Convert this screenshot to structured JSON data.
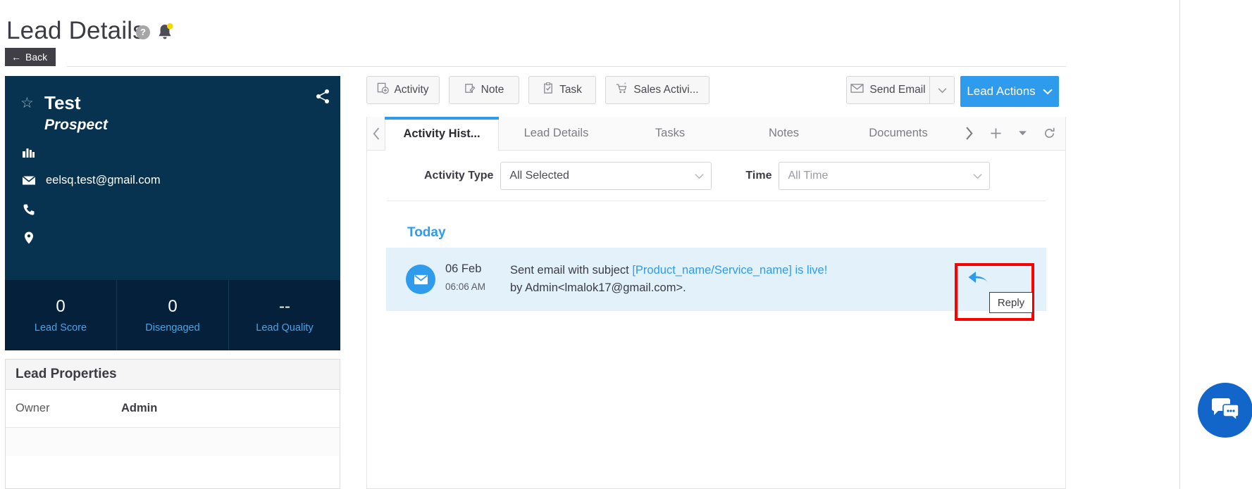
{
  "header": {
    "title": "Lead Details",
    "help_icon": "help-circle-icon",
    "bell_icon": "bell-notification-icon",
    "back_label": "Back",
    "back_arrow": "←"
  },
  "lead_card": {
    "star_icon": "star-outline-icon",
    "share_icon": "share-nodes-icon",
    "name": "Test",
    "stage": "Prospect",
    "rows": [
      {
        "icon": "company-building-icon",
        "value": ""
      },
      {
        "icon": "envelope-icon",
        "value": "eelsq.test@gmail.com"
      },
      {
        "icon": "phone-icon",
        "value": ""
      },
      {
        "icon": "location-pin-icon",
        "value": ""
      }
    ],
    "stats": [
      {
        "value": "0",
        "label": "Lead Score"
      },
      {
        "value": "0",
        "label": "Disengaged"
      },
      {
        "value": "--",
        "label": "Lead Quality"
      }
    ]
  },
  "lead_properties": {
    "title": "Lead Properties",
    "rows": [
      {
        "key": "Owner",
        "value": "Admin"
      }
    ]
  },
  "toolbar": {
    "activity_label": "Activity",
    "activity_icon": "activity-add-icon",
    "note_label": "Note",
    "note_icon": "note-pencil-icon",
    "task_label": "Task",
    "task_icon": "clipboard-check-icon",
    "sales_label": "Sales Activi...",
    "sales_icon": "cart-star-icon",
    "send_email_label": "Send Email",
    "send_email_icon": "envelope-icon",
    "send_email_caret": "chevron-down-icon",
    "lead_actions_label": "Lead Actions",
    "lead_actions_caret": "chevron-down-icon"
  },
  "tabs": {
    "scroll_left_icon": "chevron-left-icon",
    "items": [
      {
        "label": "Activity Hist...",
        "active": true
      },
      {
        "label": "Lead Details",
        "active": false
      },
      {
        "label": "Tasks",
        "active": false
      },
      {
        "label": "Notes",
        "active": false
      },
      {
        "label": "Documents",
        "active": false
      }
    ],
    "tools": [
      {
        "icon": "chevron-right-icon"
      },
      {
        "icon": "plus-icon"
      },
      {
        "icon": "chevron-down-icon"
      },
      {
        "icon": "refresh-icon"
      }
    ]
  },
  "filters": {
    "activity_type_label": "Activity Type",
    "activity_type_value": "All Selected",
    "time_label": "Time",
    "time_value": "All Time",
    "caret_icon": "chevron-down-icon"
  },
  "activity_feed": {
    "group_label": "Today",
    "items": [
      {
        "icon": "email-envelope-icon",
        "date": "06 Feb",
        "time": "06:06 AM",
        "text_prefix": "Sent email with subject ",
        "subject_link": "[Product_name/Service_name] is live!",
        "text_middle": " by ",
        "sender_link": "Admin<lmalok17@gmail.com>",
        "text_suffix": "."
      }
    ]
  },
  "reply_control": {
    "icon": "reply-arrow-icon",
    "tooltip": "Reply",
    "highlight_color": "#ff0000"
  },
  "chat_widget": {
    "icon": "chat-bubbles-icon",
    "color": "#1266c9"
  },
  "colors": {
    "card_bg": "#083350",
    "stats_bg": "#04203a",
    "accent_blue": "#2f9bec",
    "link_blue": "#4aa3e8",
    "activity_row_bg": "#e3f1fb"
  }
}
